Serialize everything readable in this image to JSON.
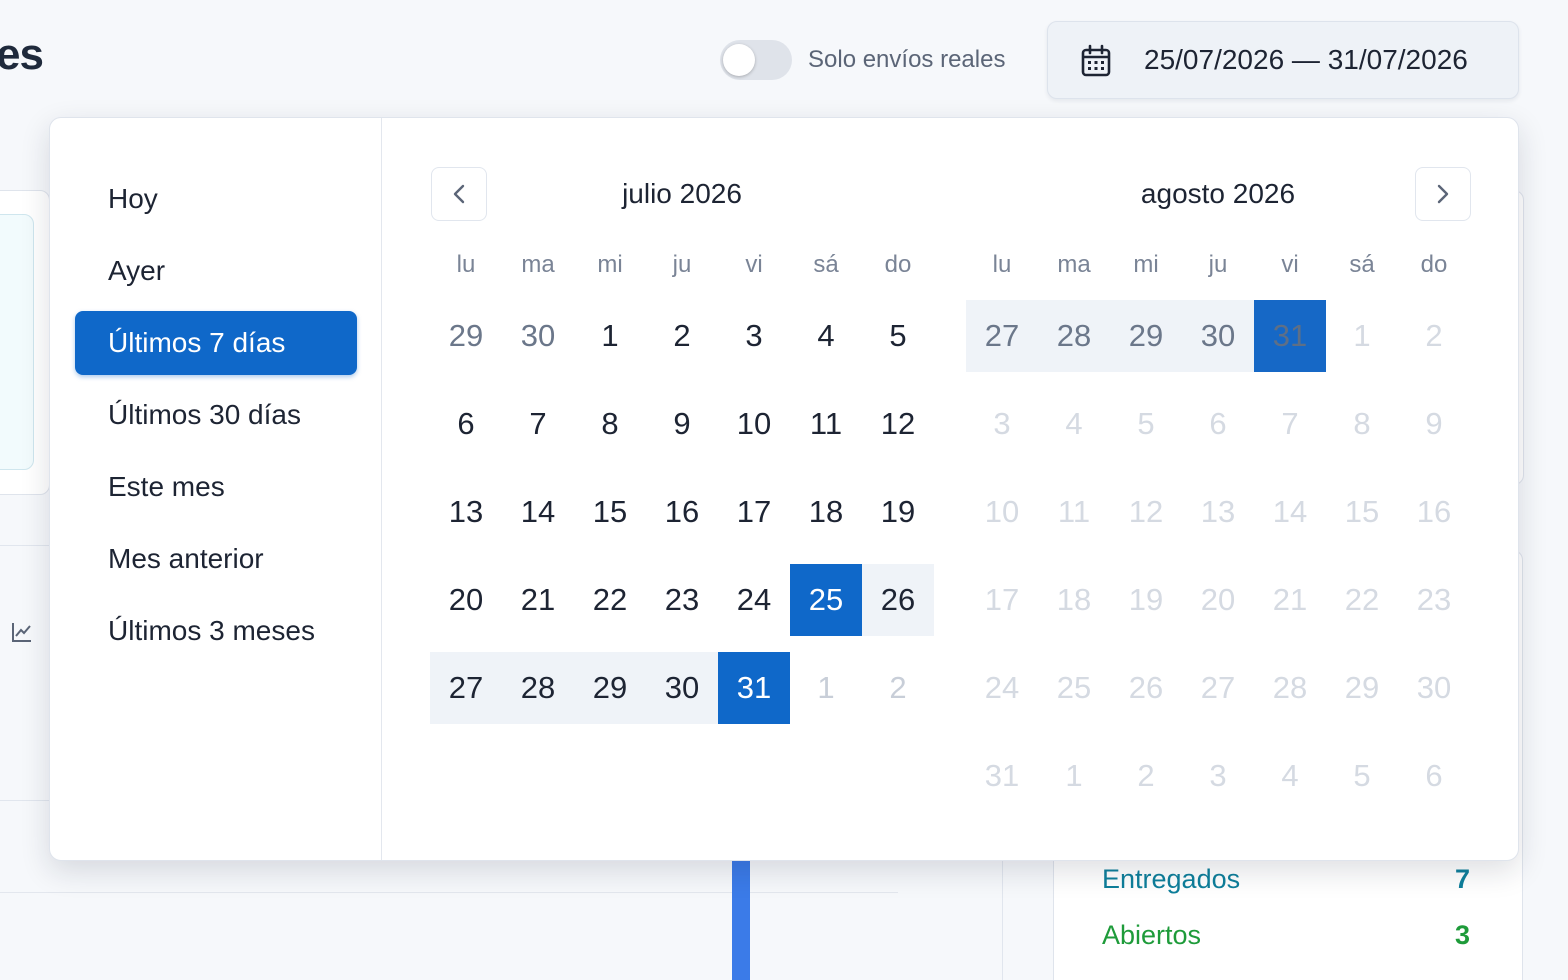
{
  "header": {
    "title_fragment": "es",
    "toggle_label": "Solo envíos reales",
    "date_range": "25/07/2026 — 31/07/2026"
  },
  "stats": [
    {
      "label": "Entregados",
      "value": "7",
      "color": "#0e7f9b"
    },
    {
      "label": "Abiertos",
      "value": "3",
      "color": "#1e9b3a"
    }
  ],
  "presets": [
    {
      "label": "Hoy",
      "active": false
    },
    {
      "label": "Ayer",
      "active": false
    },
    {
      "label": "Últimos 7 días",
      "active": true
    },
    {
      "label": "Últimos 30 días",
      "active": false
    },
    {
      "label": "Este mes",
      "active": false
    },
    {
      "label": "Mes anterior",
      "active": false
    },
    {
      "label": "Últimos 3 meses",
      "active": false
    }
  ],
  "weekdays": [
    "lu",
    "ma",
    "mi",
    "ju",
    "vi",
    "sá",
    "do"
  ],
  "months": [
    {
      "title": "julio 2026",
      "weeks": [
        [
          {
            "d": "29",
            "s": "prev"
          },
          {
            "d": "30",
            "s": "prev"
          },
          {
            "d": "1",
            "s": ""
          },
          {
            "d": "2",
            "s": ""
          },
          {
            "d": "3",
            "s": ""
          },
          {
            "d": "4",
            "s": ""
          },
          {
            "d": "5",
            "s": ""
          }
        ],
        [
          {
            "d": "6",
            "s": ""
          },
          {
            "d": "7",
            "s": ""
          },
          {
            "d": "8",
            "s": ""
          },
          {
            "d": "9",
            "s": ""
          },
          {
            "d": "10",
            "s": ""
          },
          {
            "d": "11",
            "s": ""
          },
          {
            "d": "12",
            "s": ""
          }
        ],
        [
          {
            "d": "13",
            "s": ""
          },
          {
            "d": "14",
            "s": ""
          },
          {
            "d": "15",
            "s": ""
          },
          {
            "d": "16",
            "s": ""
          },
          {
            "d": "17",
            "s": ""
          },
          {
            "d": "18",
            "s": ""
          },
          {
            "d": "19",
            "s": ""
          }
        ],
        [
          {
            "d": "20",
            "s": ""
          },
          {
            "d": "21",
            "s": ""
          },
          {
            "d": "22",
            "s": ""
          },
          {
            "d": "23",
            "s": ""
          },
          {
            "d": "24",
            "s": ""
          },
          {
            "d": "25",
            "s": "sel"
          },
          {
            "d": "26",
            "s": "range"
          }
        ],
        [
          {
            "d": "27",
            "s": "range"
          },
          {
            "d": "28",
            "s": "range"
          },
          {
            "d": "29",
            "s": "range"
          },
          {
            "d": "30",
            "s": "range"
          },
          {
            "d": "31",
            "s": "sel"
          },
          {
            "d": "1",
            "s": "out"
          },
          {
            "d": "2",
            "s": "out"
          }
        ]
      ]
    },
    {
      "title": "agosto 2026",
      "weeks": [
        [
          {
            "d": "27",
            "s": "range-dim"
          },
          {
            "d": "28",
            "s": "range-dim"
          },
          {
            "d": "29",
            "s": "range-dim"
          },
          {
            "d": "30",
            "s": "range-dim"
          },
          {
            "d": "31",
            "s": "sel-dim"
          },
          {
            "d": "1",
            "s": "disabled"
          },
          {
            "d": "2",
            "s": "disabled"
          }
        ],
        [
          {
            "d": "3",
            "s": "disabled"
          },
          {
            "d": "4",
            "s": "disabled"
          },
          {
            "d": "5",
            "s": "disabled"
          },
          {
            "d": "6",
            "s": "disabled"
          },
          {
            "d": "7",
            "s": "disabled"
          },
          {
            "d": "8",
            "s": "disabled"
          },
          {
            "d": "9",
            "s": "disabled"
          }
        ],
        [
          {
            "d": "10",
            "s": "disabled"
          },
          {
            "d": "11",
            "s": "disabled"
          },
          {
            "d": "12",
            "s": "disabled"
          },
          {
            "d": "13",
            "s": "disabled"
          },
          {
            "d": "14",
            "s": "disabled"
          },
          {
            "d": "15",
            "s": "disabled"
          },
          {
            "d": "16",
            "s": "disabled"
          }
        ],
        [
          {
            "d": "17",
            "s": "disabled"
          },
          {
            "d": "18",
            "s": "disabled"
          },
          {
            "d": "19",
            "s": "disabled"
          },
          {
            "d": "20",
            "s": "disabled"
          },
          {
            "d": "21",
            "s": "disabled"
          },
          {
            "d": "22",
            "s": "disabled"
          },
          {
            "d": "23",
            "s": "disabled"
          }
        ],
        [
          {
            "d": "24",
            "s": "disabled"
          },
          {
            "d": "25",
            "s": "disabled"
          },
          {
            "d": "26",
            "s": "disabled"
          },
          {
            "d": "27",
            "s": "disabled"
          },
          {
            "d": "28",
            "s": "disabled"
          },
          {
            "d": "29",
            "s": "disabled"
          },
          {
            "d": "30",
            "s": "disabled"
          }
        ],
        [
          {
            "d": "31",
            "s": "disabled"
          },
          {
            "d": "1",
            "s": "disabled"
          },
          {
            "d": "2",
            "s": "disabled"
          },
          {
            "d": "3",
            "s": "disabled"
          },
          {
            "d": "4",
            "s": "disabled"
          },
          {
            "d": "5",
            "s": "disabled"
          },
          {
            "d": "6",
            "s": "disabled"
          }
        ]
      ]
    }
  ],
  "icons": {
    "calendar": "calendar-icon",
    "prev": "chevron-left-icon",
    "next": "chevron-right-icon",
    "chart": "line-chart-icon"
  }
}
